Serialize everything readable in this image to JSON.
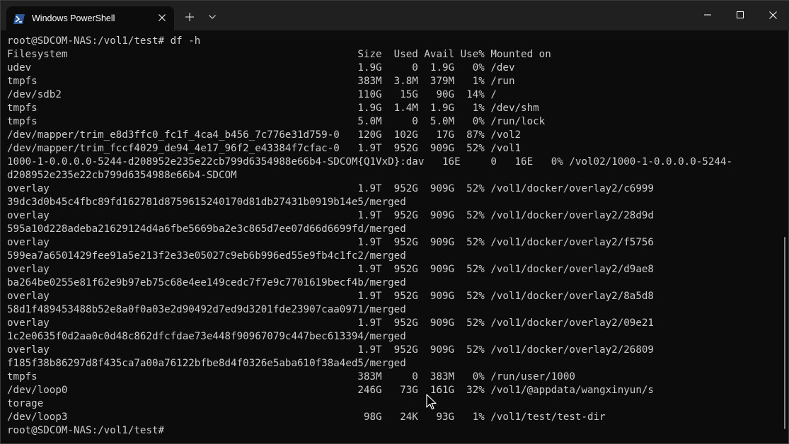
{
  "window": {
    "tab_title": "Windows PowerShell",
    "icons": {
      "tab": "powershell-icon",
      "close_tab": "close-icon",
      "new_tab": "plus-icon",
      "dropdown": "chevron-down-icon",
      "minimize": "minimize-icon",
      "maximize": "maximize-icon",
      "close": "close-icon"
    },
    "colors": {
      "titlebar": "#202020",
      "terminal_bg": "#0c0c0c",
      "text": "#cccccc",
      "tab_icon": "#1f4e9a"
    }
  },
  "terminal": {
    "lines": [
      "root@SDCOM-NAS:/vol1/test# df -h",
      "Filesystem                                                Size  Used Avail Use% Mounted on",
      "udev                                                      1.9G     0  1.9G   0% /dev",
      "tmpfs                                                     383M  3.8M  379M   1% /run",
      "/dev/sdb2                                                 110G   15G   90G  14% /",
      "tmpfs                                                     1.9G  1.4M  1.9G   1% /dev/shm",
      "tmpfs                                                     5.0M     0  5.0M   0% /run/lock",
      "/dev/mapper/trim_e8d3ffc0_fc1f_4ca4_b456_7c776e31d759-0   120G  102G   17G  87% /vol2",
      "/dev/mapper/trim_fccf4029_de94_4e17_96f2_e43384f7cfac-0   1.9T  952G  909G  52% /vol1",
      "1000-1-0.0.0.0-5244-d208952e235e22cb799d6354988e66b4-SDCOM{Q1VxD}:dav   16E     0   16E   0% /vol02/1000-1-0.0.0.0-5244-",
      "d208952e235e22cb799d6354988e66b4-SDCOM",
      "overlay                                                   1.9T  952G  909G  52% /vol1/docker/overlay2/c6999",
      "39dc3d0b45c4fbc89fd162781d8759615240170d81db27431b0919b14e5/merged",
      "overlay                                                   1.9T  952G  909G  52% /vol1/docker/overlay2/28d9d",
      "595a10d228adeba21629124d4a6fbe5669ba2e3c865d7ee07d66d6699fd/merged",
      "overlay                                                   1.9T  952G  909G  52% /vol1/docker/overlay2/f5756",
      "599ea7a6501429fee91a5e213f2e33e05027c9eb6b996ed55e9fb4c1fc2/merged",
      "overlay                                                   1.9T  952G  909G  52% /vol1/docker/overlay2/d9ae8",
      "ba264be0255e81f62e9b97eb75c68e4ee149cedc7f7e9c7701619becf4b/merged",
      "overlay                                                   1.9T  952G  909G  52% /vol1/docker/overlay2/8a5d8",
      "58d1f489453488b52e8a0f0a03e2d90492d7ed9d3201fde23907caa0971/merged",
      "overlay                                                   1.9T  952G  909G  52% /vol1/docker/overlay2/09e21",
      "1c2e0635f0d2aa0c0d48c862dfcfdae73e448f90967079c447bec613394/merged",
      "overlay                                                   1.9T  952G  909G  52% /vol1/docker/overlay2/26809",
      "f185f38b86297d8f435ca7a00a76122bfbe8d4f0326e5aba610f38a4ed5/merged",
      "tmpfs                                                     383M     0  383M   0% /run/user/1000",
      "/dev/loop0                                                246G   73G  161G  32% /vol1/@appdata/wangxinyun/s",
      "torage",
      "/dev/loop3                                                 98G   24K   93G   1% /vol1/test/test-dir",
      "root@SDCOM-NAS:/vol1/test#"
    ]
  }
}
